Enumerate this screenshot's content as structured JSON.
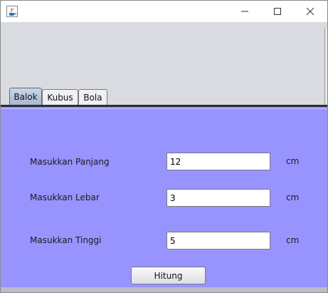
{
  "window": {
    "icon": "java-cup-icon",
    "title": ""
  },
  "tabs": [
    {
      "label": "Balok",
      "active": true
    },
    {
      "label": "Kubus",
      "active": false
    },
    {
      "label": "Bola",
      "active": false
    }
  ],
  "form": {
    "panjang": {
      "label": "Masukkan Panjang",
      "value": "12",
      "unit": "cm"
    },
    "lebar": {
      "label": "Masukkan Lebar",
      "value": "3",
      "unit": "cm"
    },
    "tinggi": {
      "label": "Masukkan Tinggi",
      "value": "5",
      "unit": "cm"
    },
    "button_label": "Hitung"
  },
  "colors": {
    "panel_background": "#9894ff",
    "header_background": "#d9dbe0"
  }
}
